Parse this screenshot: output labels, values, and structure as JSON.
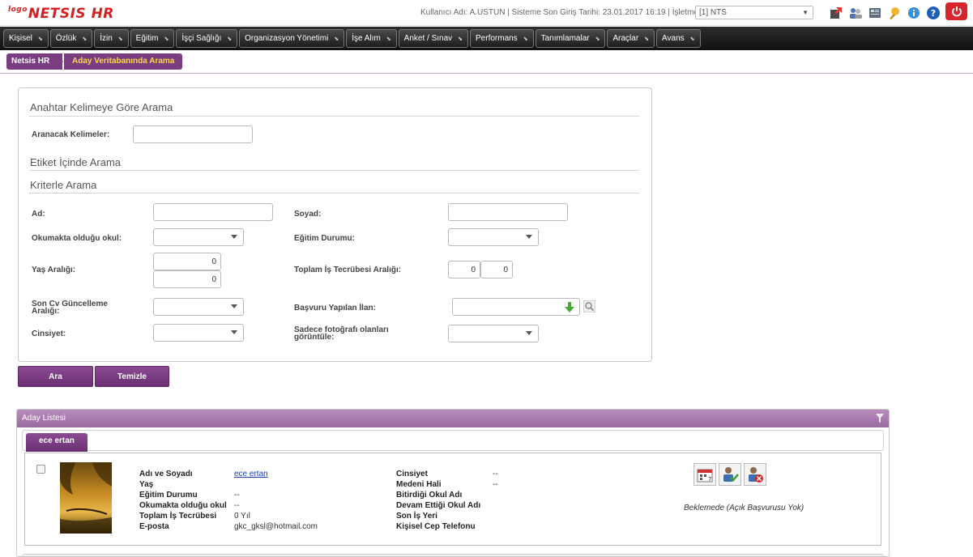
{
  "header": {
    "logo_prefix": "logo",
    "logo_text": "NETSIS HR",
    "user_info": "Kullanıcı Adı: A.USTUN | Sisteme Son Giriş Tarihi: 23.01.2017 16:19 | İşletme:",
    "company_selected": "[1] NTS",
    "tool_icons": [
      "external-link-icon",
      "users-icon",
      "report-icon",
      "award-icon",
      "info-icon",
      "help-icon"
    ],
    "power_icon": "power-icon"
  },
  "nav": {
    "items": [
      "Kişisel",
      "Özlük",
      "İzin",
      "Eğitim",
      "İşçi Sağlığı",
      "Organizasyon Yönetimi",
      "İşe Alım",
      "Anket / Sınav",
      "Performans",
      "Tanımlamalar",
      "Araçlar",
      "Avans"
    ]
  },
  "breadcrumb": {
    "home": "Netsis HR",
    "current": "Aday Veritabanında Arama"
  },
  "search": {
    "keyword_section": "Anahtar Kelimeye Göre Arama",
    "keyword_label": "Aranacak Kelimeler:",
    "keyword_value": "",
    "tag_section": "Etiket İçinde Arama",
    "criteria_section": "Kriterle Arama",
    "ad_label": "Ad:",
    "soyad_label": "Soyad:",
    "okul_label": "Okumakta olduğu okul:",
    "egitim_label": "Eğitim Durumu:",
    "yas_label": "Yaş Aralığı:",
    "yas_min": "0",
    "yas_max": "0",
    "tecrube_label": "Toplam İş Tecrübesi Aralığı:",
    "tecrube_min": "0",
    "tecrube_max": "0",
    "cv_label_1": "Son Cv Güncelleme",
    "cv_label_2": "Aralığı:",
    "ilan_label": "Başvuru Yapılan İlan:",
    "cinsiyet_label": "Cinsiyet:",
    "foto_label_1": "Sadece fotoğrafı olanları",
    "foto_label_2": "görüntüle:"
  },
  "buttons": {
    "search": "Ara",
    "clear": "Temizle"
  },
  "list": {
    "title": "Aday Listesi",
    "tab": "ece ertan",
    "candidate": {
      "name_label": "Adı ve Soyadı",
      "name_value": "ece ertan",
      "age_label": "Yaş",
      "education_label": "Eğitim Durumu",
      "education_value": "--",
      "school_label": "Okumakta olduğu okul",
      "school_value": "--",
      "experience_label": "Toplam İş Tecrübesi",
      "experience_value": "0 Yıl",
      "email_label": "E-posta",
      "email_value": "gkc_gksl@hotmail.com",
      "gender_label": "Cinsiyet",
      "gender_value": "--",
      "marital_label": "Medeni Hali",
      "marital_value": "--",
      "graduated_label": "Bitirdiği Okul Adı",
      "continuing_label": "Devam Ettiği Okul Adı",
      "lastjob_label": "Son İş Yeri",
      "phone_label": "Kişisel Cep Telefonu",
      "status": "Beklemede (Açık Başvurusu Yok)"
    }
  }
}
